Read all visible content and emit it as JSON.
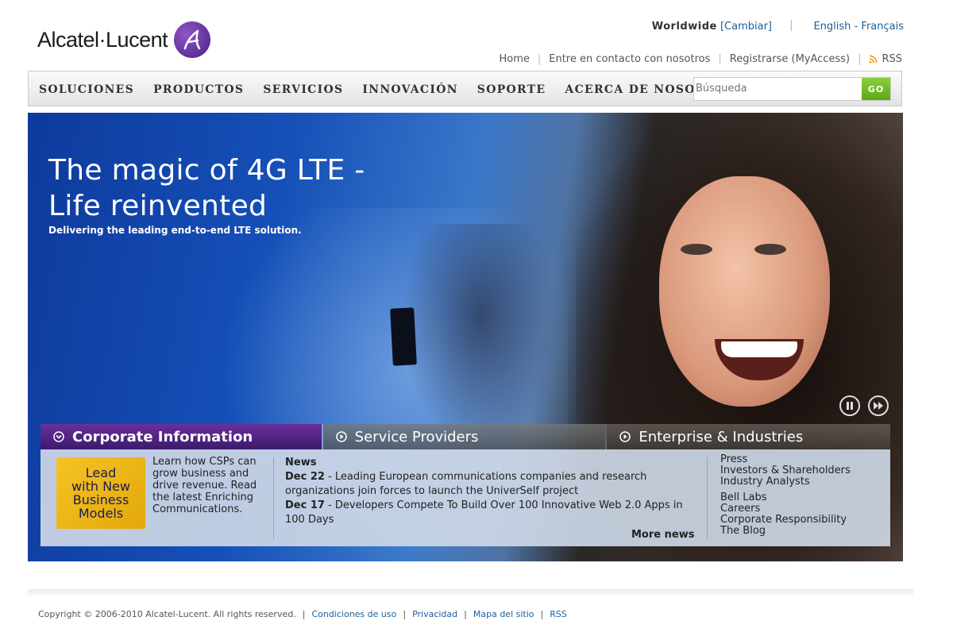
{
  "brand": {
    "name": "Alcatel·Lucent"
  },
  "top": {
    "worldwide_label": "Worldwide",
    "change_label": "[Cambiar]",
    "lang_en": "English",
    "lang_sep": "-",
    "lang_fr": "Français"
  },
  "utility_links": [
    {
      "label": "Home"
    },
    {
      "label": "Entre en contacto con nosotros"
    },
    {
      "label": "Registrarse (MyAccess)"
    },
    {
      "label": "RSS"
    }
  ],
  "nav": {
    "items": [
      "SOLUCIONES",
      "PRODUCTOS",
      "SERVICIOS",
      "INNOVACIÓN",
      "SOPORTE",
      "ACERCA DE NOSOTROS"
    ],
    "search_placeholder": "Búsqueda",
    "go_label": "GO"
  },
  "hero": {
    "headline_1": "The magic of 4G LTE -",
    "headline_2": "Life reinvented",
    "subline": "Delivering the leading end-to-end LTE solution."
  },
  "tabs": [
    {
      "label": "Corporate Information",
      "active": true
    },
    {
      "label": "Service Providers",
      "active": false
    },
    {
      "label": "Enterprise & Industries",
      "active": false
    }
  ],
  "panel": {
    "promo_lines": [
      "Lead",
      "with New",
      "Business",
      "Models"
    ],
    "promo_text": "Learn how CSPs can grow business and drive revenue. Read the latest Enriching Communications.",
    "news_heading": "News",
    "news": [
      {
        "date": "Dec 22",
        "text": " - Leading European communications companies and research organizations join forces to launch the UniverSelf project"
      },
      {
        "date": "Dec 17",
        "text": " - Developers Compete To Build Over 100 Innovative Web 2.0 Apps in 100 Days"
      }
    ],
    "more_news": "More news",
    "links_group1": [
      "Press",
      "Investors & Shareholders",
      "Industry Analysts"
    ],
    "links_group2": [
      "Bell Labs",
      "Careers",
      "Corporate Responsibility",
      "The Blog"
    ]
  },
  "footer": {
    "copyright": "Copyright © 2006-2010 Alcatel-Lucent. All rights reserved.",
    "links": [
      "Condiciones de uso",
      "Privacidad",
      "Mapa del sitio",
      "RSS"
    ]
  },
  "colors": {
    "accent_purple": "#4a1f86",
    "link_blue": "#1c5f99",
    "go_green": "#6cb31f",
    "hero_blue": "#1550b8"
  }
}
